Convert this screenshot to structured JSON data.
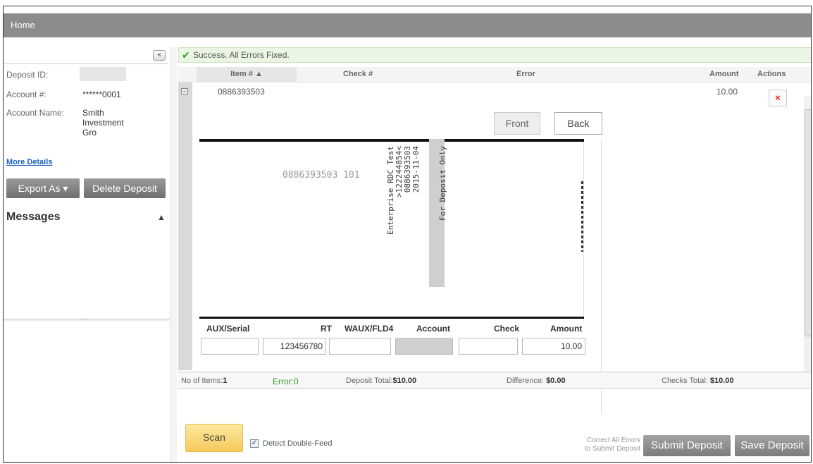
{
  "header": {
    "title": "Home"
  },
  "sidebar": {
    "collapse_icon": "«",
    "deposit_id_label": "Deposit ID:",
    "account_label": "Account #:",
    "account_value": "******0001",
    "account_name_label": "Account Name:",
    "account_name_value_1": "Smith",
    "account_name_value_2": "Investment",
    "account_name_value_3": "Gro",
    "more_details": "More Details",
    "export_label": "Export As",
    "export_arrow": "▾",
    "delete_label": "Delete Deposit",
    "messages_title": "Messages",
    "messages_arrow": "▲",
    "resize_handle": "....."
  },
  "main": {
    "success_message": "Success. All Errors Fixed.",
    "columns": {
      "item": "Item # ▲",
      "check": "Check #",
      "error": "Error",
      "amount": "Amount",
      "actions": "Actions"
    },
    "row": {
      "toggle": "−",
      "item_number": "0886393503",
      "amount": "10.00",
      "delete_icon": "×"
    },
    "tabs": {
      "front": "Front",
      "back": "Back"
    },
    "check_image": {
      "micr_line": "0886393503 101",
      "endorsement_lines": [
        "For Deposit Only",
        "2015-11-04",
        "0886393503",
        ">122244854<",
        "Enterprise RDC Test"
      ]
    },
    "micr": {
      "headers": {
        "aux": "AUX/Serial",
        "rt": "RT",
        "waux": "WAUX/FLD4",
        "account": "Account",
        "check": "Check",
        "amount": "Amount"
      },
      "rt_value": "123456780",
      "amount_value": "10.00"
    },
    "summary": {
      "items_label": "No of Items:",
      "items_value": "1",
      "error_label": "Error:",
      "error_value": "0",
      "deposit_total_label": "Deposit Total:",
      "deposit_total_value": "$10.00",
      "difference_label": "Difference:",
      "difference_value": "$0.00",
      "checks_total_label": "Checks Total:",
      "checks_total_value": "$10.00"
    },
    "footer": {
      "scan_label": "Scan",
      "detect_label": "Detect Double-Feed",
      "detect_checked": "✓",
      "correct_note_1": "Correct All Errors",
      "correct_note_2": "to Submit Deposit",
      "submit_label": "Submit Deposit",
      "save_label": "Save Deposit"
    }
  },
  "colors": {
    "header_bar": "#8c8c8c",
    "success_bg": "#eaf5e4",
    "scan_button": "#f7c95a",
    "error_ok": "#3a9a2a",
    "link": "#1a5fbd"
  }
}
